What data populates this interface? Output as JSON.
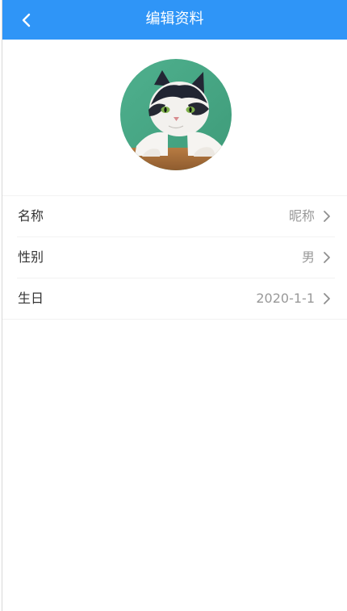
{
  "header": {
    "title": "编辑资料",
    "back_icon": "chevron-left-icon",
    "background": "#2f95f7"
  },
  "avatar": {
    "description": "cat profile photo"
  },
  "profile": {
    "rows": [
      {
        "label": "名称",
        "value": "昵称",
        "icon": "chevron-right-icon"
      },
      {
        "label": "性别",
        "value": "男",
        "icon": "chevron-right-icon"
      },
      {
        "label": "生日",
        "value": "2020-1-1",
        "icon": "chevron-right-icon"
      }
    ]
  },
  "colors": {
    "accent": "#2f95f7",
    "label": "#333333",
    "value": "#999999",
    "divider": "#f2f2f2"
  }
}
